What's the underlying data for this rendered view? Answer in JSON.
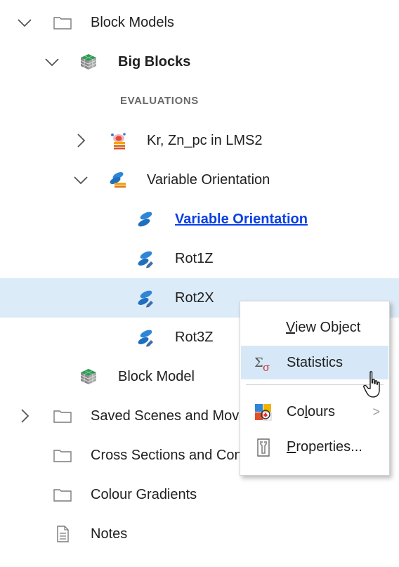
{
  "tree": {
    "block_models": {
      "label": "Block Models",
      "expanded": true,
      "icon": "folder-icon"
    },
    "big_blocks": {
      "label": "Big Blocks",
      "expanded": true,
      "icon": "block-model-icon"
    },
    "evaluations_header": "EVALUATIONS",
    "kr_zn": {
      "label": "Kr, Zn_pc in LMS2",
      "expanded": false,
      "icon": "estimator-icon"
    },
    "variable_orientation": {
      "label": "Variable Orientation",
      "expanded": true,
      "icon": "variable-orientation-icon"
    },
    "vo_children": [
      {
        "label": "Variable Orientation",
        "link": true,
        "icon": "variable-orientation-icon"
      },
      {
        "label": "Rot1Z",
        "icon": "rotation-icon"
      },
      {
        "label": "Rot2X",
        "selected": true,
        "icon": "rotation-icon"
      },
      {
        "label": "Rot3Z",
        "icon": "rotation-icon"
      }
    ],
    "block_model": {
      "label": "Block Model",
      "icon": "block-model-icon"
    },
    "saved_scenes": {
      "label": "Saved Scenes and Movies",
      "expanded": false,
      "icon": "folder-icon"
    },
    "cross_sections": {
      "label": "Cross Sections and Contours",
      "icon": "folder-icon"
    },
    "colour_gradients": {
      "label": "Colour Gradients",
      "icon": "folder-icon"
    },
    "notes": {
      "label": "Notes",
      "icon": "notes-icon"
    }
  },
  "context_menu": {
    "view_object": {
      "prefix": "",
      "accel": "V",
      "rest": "iew Object"
    },
    "statistics": {
      "label": "Statistics",
      "icon": "statistics-icon"
    },
    "colours": {
      "prefix": "Co",
      "accel": "l",
      "rest": "ours",
      "icon": "colours-icon",
      "arrow": ">"
    },
    "properties": {
      "prefix": "",
      "accel": "P",
      "rest": "roperties...",
      "icon": "properties-icon"
    }
  },
  "colors": {
    "selection": "#dcebf8",
    "menu_hover": "#d6e8f8",
    "link": "#0b3fe6"
  }
}
